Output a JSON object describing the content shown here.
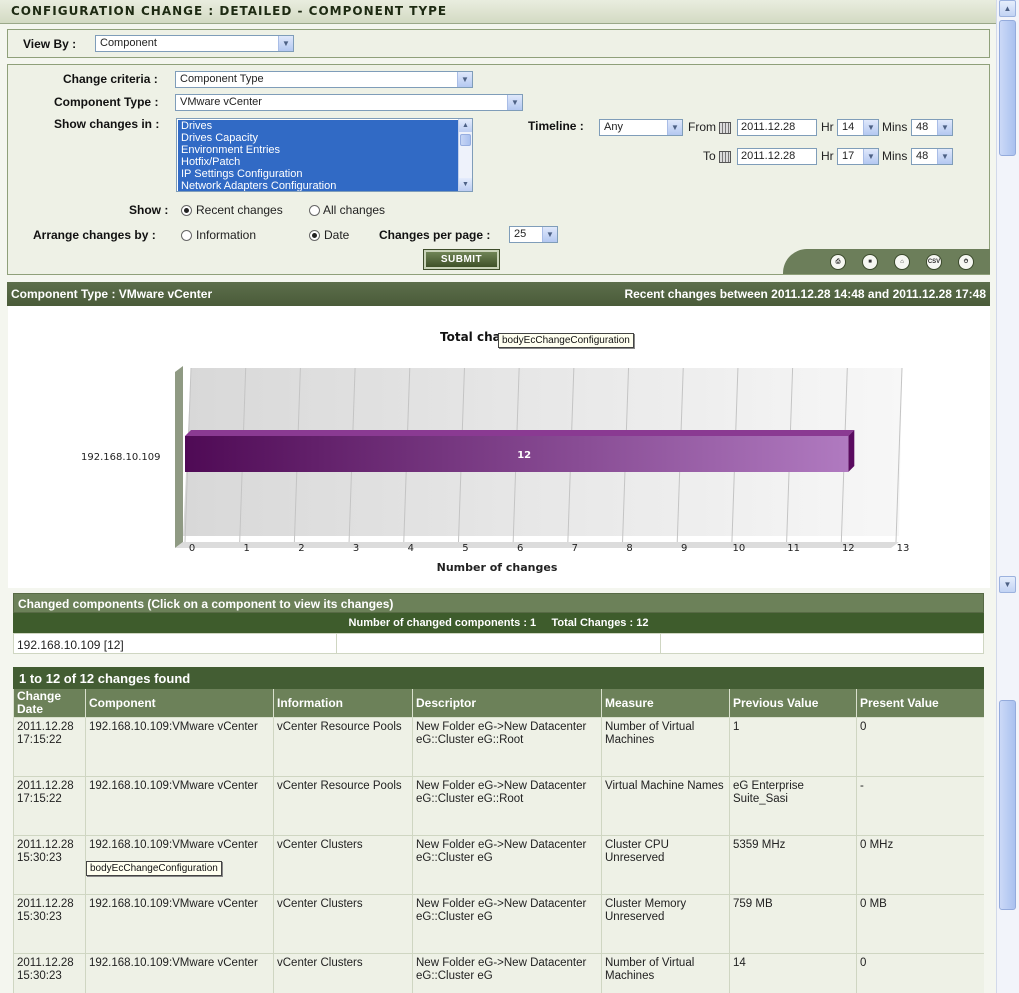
{
  "page_title": "CONFIGURATION CHANGE : DETAILED - COMPONENT TYPE",
  "view_by": {
    "label": "View By :",
    "value": "Component"
  },
  "filters": {
    "change_criteria": {
      "label": "Change criteria :",
      "value": "Component Type"
    },
    "component_type": {
      "label": "Component Type :",
      "value": "VMware vCenter"
    },
    "show_changes_in": {
      "label": "Show changes in :",
      "options": [
        "Drives",
        "Drives Capacity",
        "Environment Entries",
        "Hotfix/Patch",
        "IP Settings Configuration",
        "Network Adapters Configuration"
      ]
    },
    "timeline": {
      "label": "Timeline :",
      "value": "Any",
      "from_label": "From",
      "from_date": "2011.12.28",
      "from_hr": "14",
      "from_mins": "48",
      "to_label": "To",
      "to_date": "2011.12.28",
      "to_hr": "17",
      "to_mins": "48",
      "hr_label": "Hr",
      "mins_label": "Mins"
    },
    "show": {
      "label": "Show :",
      "recent": "Recent changes",
      "all": "All changes",
      "selected": "recent"
    },
    "arrange": {
      "label": "Arrange changes by :",
      "information": "Information",
      "date": "Date",
      "selected": "date"
    },
    "per_page": {
      "label": "Changes per page :",
      "value": "25"
    },
    "submit_label": "SUBMIT"
  },
  "toolbar_icons": [
    "print-icon",
    "pdf-icon",
    "home-icon",
    "csv-icon",
    "timer-icon"
  ],
  "toolbar_icon_text": {
    "csv": "CSV"
  },
  "result_header": {
    "left": "Component Type : VMware vCenter",
    "right": "Recent changes between 2011.12.28 14:48 and 2011.12.28 17:48"
  },
  "chart_data": {
    "type": "bar",
    "orientation": "horizontal",
    "title": "Total cha",
    "categories": [
      "192.168.10.109"
    ],
    "values": [
      12
    ],
    "data_labels": [
      "12"
    ],
    "xlabel": "Number of changes",
    "ylabel": "",
    "xlim": [
      0,
      13
    ],
    "xticks": [
      "0",
      "1",
      "2",
      "3",
      "4",
      "5",
      "6",
      "7",
      "8",
      "9",
      "10",
      "11",
      "12",
      "13"
    ],
    "grid": true,
    "bar_color": "#6a1a6e"
  },
  "tooltip_chart": "bodyEcChangeConfiguration",
  "tooltip_table": "bodyEcChangeConfiguration",
  "changed_components": {
    "title": "Changed components (Click on a component to view its changes)",
    "summary": "Number of changed components : 1     Total Changes : 12",
    "items": [
      "192.168.10.109 [12]"
    ]
  },
  "changes_table": {
    "caption": "1 to 12 of 12 changes found",
    "headers": [
      "Change Date",
      "Component",
      "Information",
      "Descriptor",
      "Measure",
      "Previous Value",
      "Present Value"
    ],
    "rows": [
      [
        "2011.12.28 17:15:22",
        "192.168.10.109:VMware vCenter",
        "vCenter Resource Pools",
        "New Folder eG->New Datacenter eG::Cluster eG::Root",
        "Number of Virtual Machines",
        "1",
        "0"
      ],
      [
        "2011.12.28 17:15:22",
        "192.168.10.109:VMware vCenter",
        "vCenter Resource Pools",
        "New Folder eG->New Datacenter eG::Cluster eG::Root",
        "Virtual Machine Names",
        "eG Enterprise Suite_Sasi",
        "-"
      ],
      [
        "2011.12.28 15:30:23",
        "192.168.10.109:VMware vCenter",
        "vCenter Clusters",
        "New Folder eG->New Datacenter eG::Cluster eG",
        "Cluster CPU Unreserved",
        "5359 MHz",
        "0 MHz"
      ],
      [
        "2011.12.28 15:30:23",
        "192.168.10.109:VMware vCenter",
        "vCenter Clusters",
        "New Folder eG->New Datacenter eG::Cluster eG",
        "Cluster Memory Unreserved",
        "759 MB",
        "0 MB"
      ],
      [
        "2011.12.28 15:30:23",
        "192.168.10.109:VMware vCenter",
        "vCenter Clusters",
        "New Folder eG->New Datacenter eG::Cluster eG",
        "Number of Virtual Machines",
        "14",
        "0"
      ]
    ]
  }
}
